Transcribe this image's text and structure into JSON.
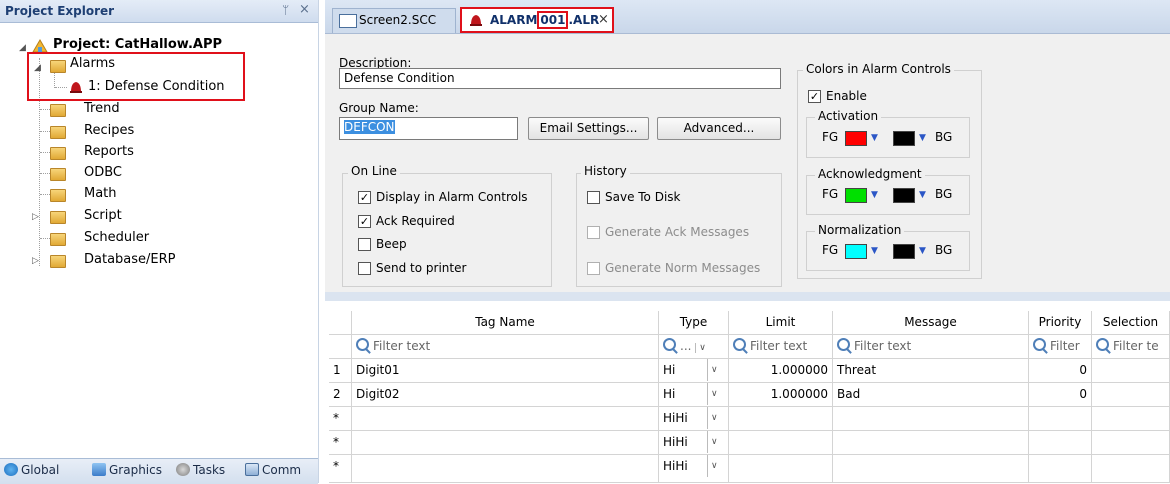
{
  "explorer": {
    "title": "Project Explorer",
    "pin_glyph": "ᛘ",
    "close_glyph": "×",
    "project": "Project: CatHallow.APP",
    "tree": {
      "alarms": "Alarms",
      "alarm_group": "1: Defense Condition",
      "trend": "Trend",
      "recipes": "Recipes",
      "reports": "Reports",
      "odbc": "ODBC",
      "math": "Math",
      "script": "Script",
      "scheduler": "Scheduler",
      "database": "Database/ERP"
    },
    "footer": {
      "global": "Global",
      "graphics": "Graphics",
      "tasks": "Tasks",
      "comm": "Comm"
    }
  },
  "tabs": {
    "tab1": "Screen2.SCC",
    "tab2_prefix": "ALARM",
    "tab2_highlight": "001",
    "tab2_suffix": ".ALR",
    "tab2_close": "×"
  },
  "form": {
    "description_label": "Description:",
    "description_value": "Defense Condition",
    "group_name_label": "Group Name:",
    "group_name_value": "DEFCON",
    "email_button": "Email Settings...",
    "advanced_button": "Advanced...",
    "online": {
      "title": "On Line",
      "display": "Display in Alarm Controls",
      "ack": "Ack Required",
      "beep": "Beep",
      "printer": "Send to printer"
    },
    "history": {
      "title": "History",
      "save": "Save To Disk",
      "gen_ack": "Generate Ack Messages",
      "gen_norm": "Generate Norm Messages"
    },
    "colors": {
      "title": "Colors in Alarm Controls",
      "enable": "Enable",
      "activation": "Activation",
      "acknowledgment": "Acknowledgment",
      "normalization": "Normalization",
      "fg": "FG",
      "bg": "BG",
      "activation_fg": "#ff0000",
      "ack_fg": "#00e000",
      "norm_fg": "#00ffff",
      "bg_color": "#000000"
    }
  },
  "grid": {
    "headers": {
      "tag": "Tag Name",
      "type": "Type",
      "limit": "Limit",
      "message": "Message",
      "priority": "Priority",
      "selection": "Selection"
    },
    "filter": {
      "text": "Filter text",
      "short": "Filter",
      "truncated": "Filter te",
      "type": "..."
    },
    "rows": [
      {
        "num": "1",
        "tag": "Digit01",
        "type": "Hi",
        "limit": "1.000000",
        "message": "Threat",
        "priority": "0"
      },
      {
        "num": "2",
        "tag": "Digit02",
        "type": "Hi",
        "limit": "1.000000",
        "message": "Bad",
        "priority": "0"
      },
      {
        "num": "*",
        "tag": "",
        "type": "HiHi",
        "limit": "",
        "message": "",
        "priority": ""
      },
      {
        "num": "*",
        "tag": "",
        "type": "HiHi",
        "limit": "",
        "message": "",
        "priority": ""
      },
      {
        "num": "*",
        "tag": "",
        "type": "HiHi",
        "limit": "",
        "message": "",
        "priority": ""
      }
    ]
  }
}
